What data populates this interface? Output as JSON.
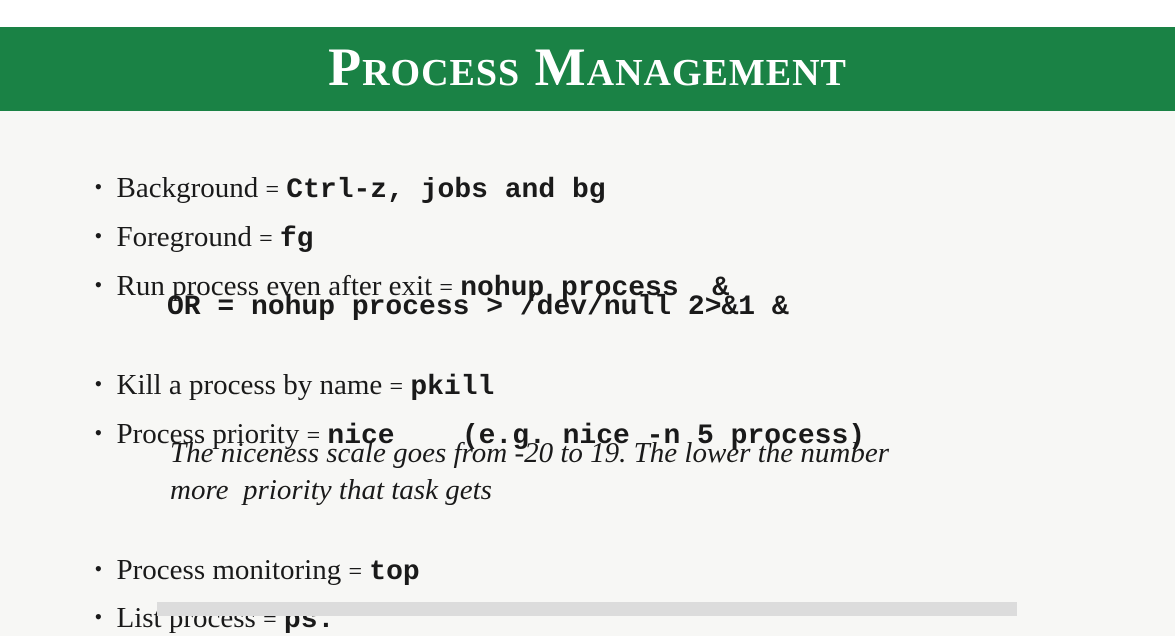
{
  "slide": {
    "title": "Process Management",
    "bullet_glyph": "•",
    "items": [
      {
        "label": "Background",
        "eq": "=",
        "code": "Ctrl-z, jobs and bg"
      },
      {
        "label": "Foreground",
        "eq": "=",
        "code": "fg"
      },
      {
        "label": "Run process even after exit",
        "eq": "=",
        "code": "nohup process  &"
      },
      {
        "label": "Kill a process by name",
        "eq": "=",
        "code": "pkill"
      },
      {
        "label": "Process priority",
        "eq": "=",
        "code": "nice    (e.g. nice -n 5 process)"
      },
      {
        "label": "Process monitoring",
        "eq": "=",
        "code": "top"
      },
      {
        "label": "List process",
        "eq": "=",
        "code": "ps."
      }
    ],
    "alt_line": "OR = nohup process > /dev/null 2>&1 &",
    "note_lines": [
      "The niceness scale goes from -20 to 19. The lower the number",
      "more  priority that task gets"
    ]
  },
  "colors": {
    "title_bar": "#1a8245",
    "title_text": "#ffffff",
    "background": "#f7f7f5"
  }
}
